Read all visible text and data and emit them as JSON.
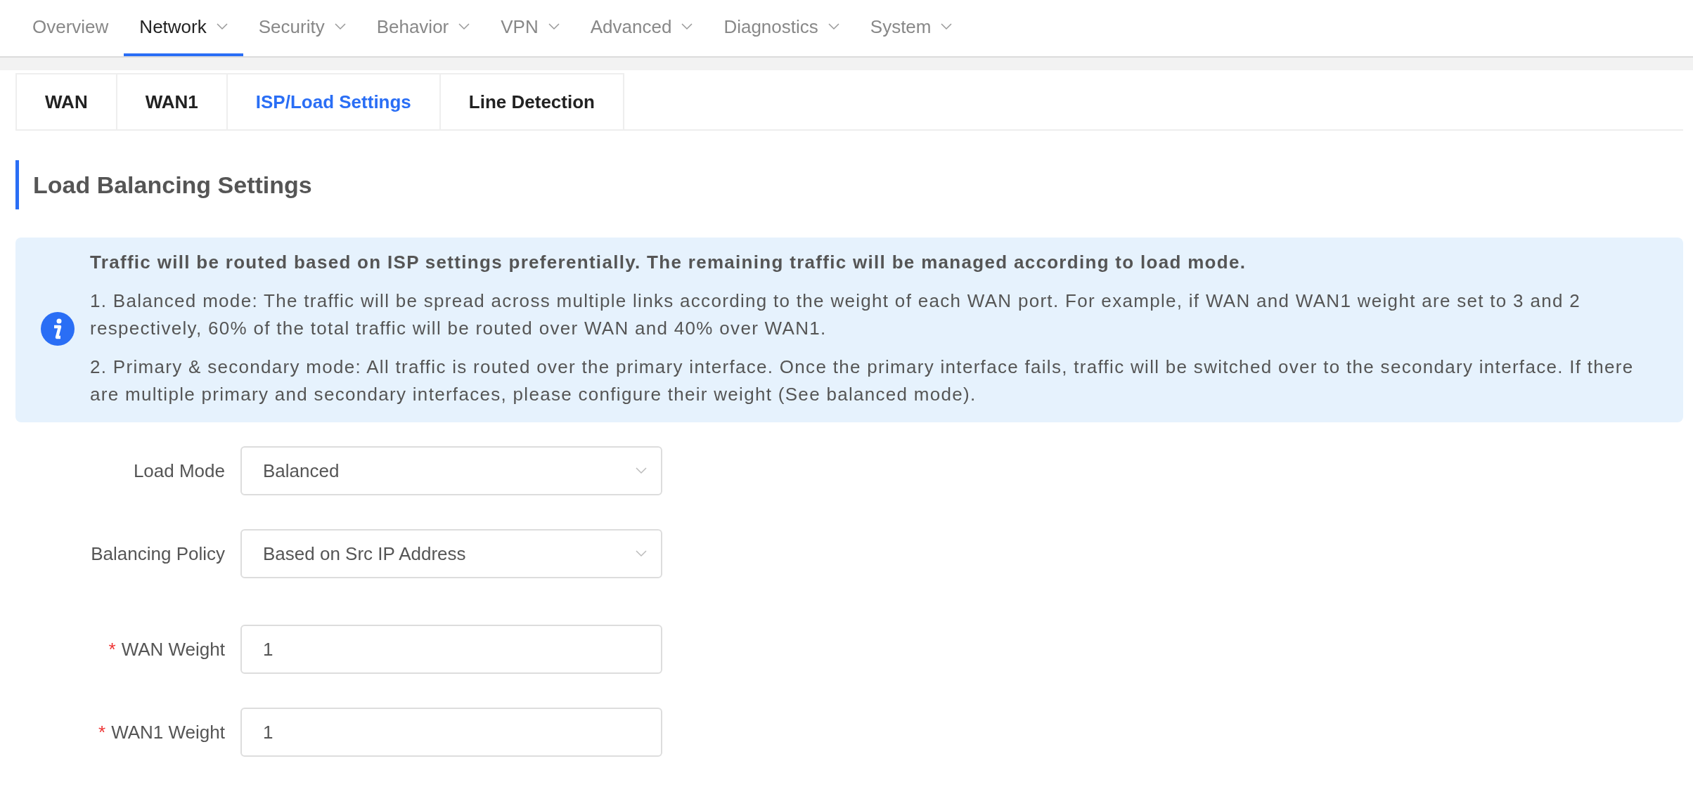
{
  "nav": [
    {
      "label": "Overview",
      "dropdown": false,
      "selected": false
    },
    {
      "label": "Network",
      "dropdown": true,
      "selected": true
    },
    {
      "label": "Security",
      "dropdown": true,
      "selected": false
    },
    {
      "label": "Behavior",
      "dropdown": true,
      "selected": false
    },
    {
      "label": "VPN",
      "dropdown": true,
      "selected": false
    },
    {
      "label": "Advanced",
      "dropdown": true,
      "selected": false
    },
    {
      "label": "Diagnostics",
      "dropdown": true,
      "selected": false
    },
    {
      "label": "System",
      "dropdown": true,
      "selected": false
    }
  ],
  "tabs": [
    {
      "label": "WAN",
      "selected": false
    },
    {
      "label": "WAN1",
      "selected": false
    },
    {
      "label": "ISP/Load Settings",
      "selected": true
    },
    {
      "label": "Line Detection",
      "selected": false
    }
  ],
  "section": {
    "title": "Load Balancing Settings"
  },
  "info": {
    "heading": "Traffic will be routed based on ISP settings preferentially. The remaining traffic will be managed according to load mode.",
    "paragraphs": [
      "1. Balanced mode: The traffic will be spread across multiple links according to the weight of each WAN port. For example, if WAN and WAN1 weight are set to 3 and 2 respectively, 60% of the total traffic will be routed over WAN and 40% over WAN1.",
      "2. Primary & secondary mode: All traffic is routed over the primary interface. Once the primary interface fails, traffic will be switched over to the secondary interface. If there are multiple primary and secondary interfaces, please configure their weight (See balanced mode)."
    ]
  },
  "form": [
    {
      "kind": "select",
      "label": "Load Mode",
      "value": "Balanced"
    },
    {
      "kind": "select",
      "label": "Balancing Policy",
      "value": "Based on Src IP Address"
    },
    {
      "kind": "input",
      "label": "WAN Weight",
      "required_mark": "*",
      "value": "1"
    },
    {
      "kind": "input",
      "label": "WAN1 Weight",
      "required_mark": "*",
      "value": "1"
    }
  ]
}
